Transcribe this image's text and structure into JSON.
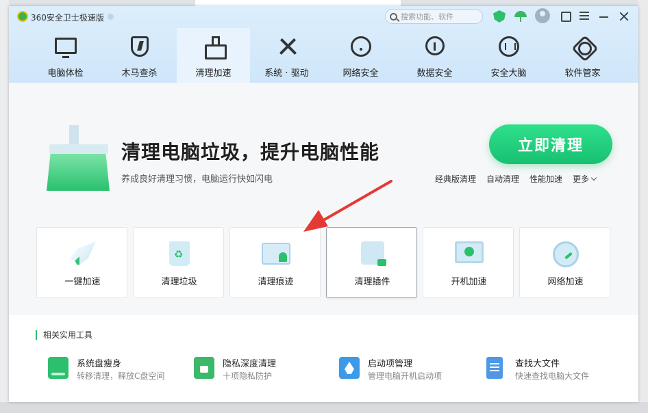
{
  "app": {
    "title": "360安全卫士极速版",
    "search_placeholder": "搜索功能、软件"
  },
  "nav": {
    "items": [
      {
        "label": "电脑体检",
        "icon": "monitor-pulse-icon"
      },
      {
        "label": "木马查杀",
        "icon": "shield-bolt-icon"
      },
      {
        "label": "清理加速",
        "icon": "broom-icon"
      },
      {
        "label": "系统 · 驱动",
        "icon": "wrench-screwdriver-icon"
      },
      {
        "label": "网络安全",
        "icon": "wifi-icon"
      },
      {
        "label": "数据安全",
        "icon": "cube-icon"
      },
      {
        "label": "安全大脑",
        "icon": "brain-icon"
      },
      {
        "label": "软件管家",
        "icon": "flower-icon"
      }
    ],
    "active_index": 2
  },
  "hero": {
    "title": "清理电脑垃圾，提升电脑性能",
    "subtitle": "养成良好清理习惯，电脑运行快如闪电",
    "primary_button": "立即清理",
    "links": [
      "经典版清理",
      "自动清理",
      "性能加速",
      "更多"
    ]
  },
  "cards": [
    {
      "label": "一键加速",
      "icon": "rocket-icon"
    },
    {
      "label": "清理垃圾",
      "icon": "recycle-bin-icon"
    },
    {
      "label": "清理痕迹",
      "icon": "window-ghost-icon"
    },
    {
      "label": "清理插件",
      "icon": "puzzle-icon"
    },
    {
      "label": "开机加速",
      "icon": "power-monitor-icon"
    },
    {
      "label": "网络加速",
      "icon": "gauge-icon"
    }
  ],
  "tools": {
    "heading": "相关实用工具",
    "items": [
      {
        "name": "系统盘瘦身",
        "desc": "转移清理，释放C盘空间",
        "icon": "disk-icon"
      },
      {
        "name": "隐私深度清理",
        "desc": "十项隐私防护",
        "icon": "privacy-lock-icon"
      },
      {
        "name": "启动项管理",
        "desc": "管理电脑开机启动项",
        "icon": "startup-rocket-icon"
      },
      {
        "name": "查找大文件",
        "desc": "快速查找电脑大文件",
        "icon": "file-search-icon"
      }
    ]
  },
  "colors": {
    "accent_green": "#1fc774",
    "header_blue": "#d3e8fb",
    "annotation_red": "#e53935"
  }
}
